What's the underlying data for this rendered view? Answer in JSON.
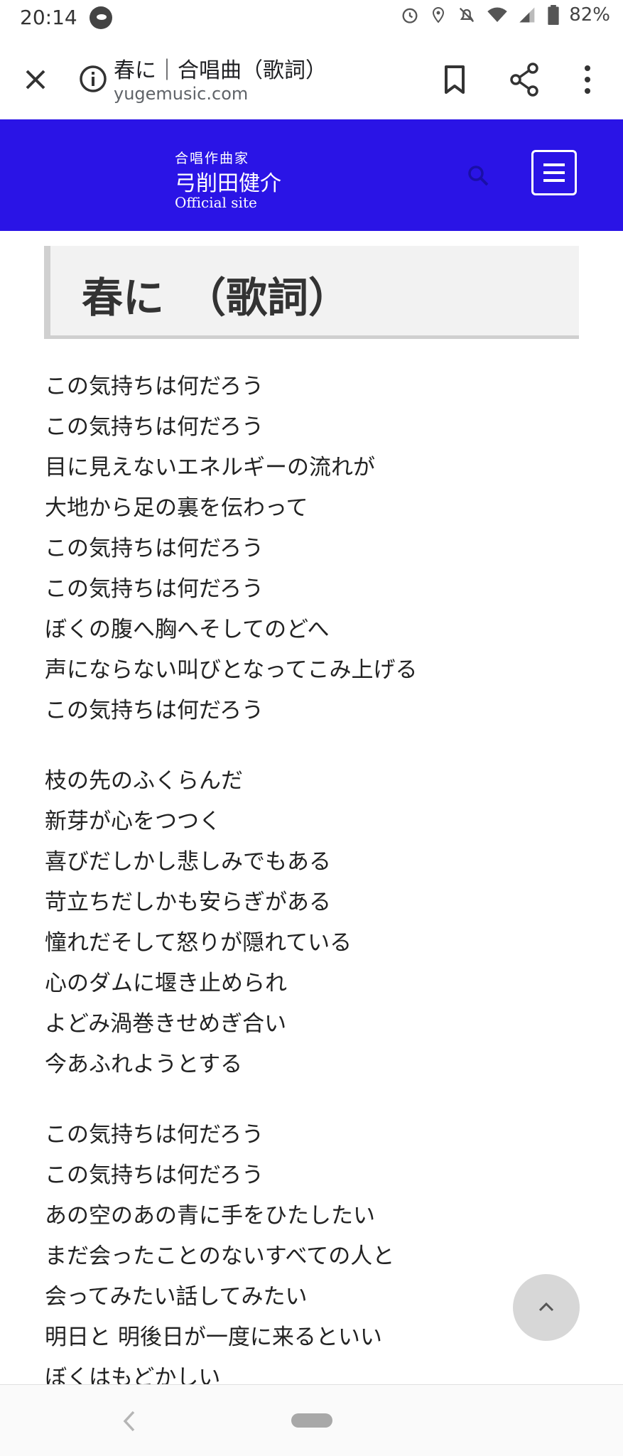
{
  "status_bar": {
    "time": "20:14",
    "battery": "82%",
    "icons": [
      "app-notification-icon",
      "alarm-icon",
      "location-icon",
      "mute-icon",
      "wifi-icon",
      "signal-icon",
      "battery-icon"
    ]
  },
  "browser": {
    "page_title": "春に｜合唱曲（歌詞）",
    "url": "yugemusic.com",
    "icons": [
      "close-icon",
      "info-icon",
      "bookmark-icon",
      "share-icon",
      "more-icon"
    ]
  },
  "site": {
    "logo_line1": "合唱作曲家",
    "logo_line2": "弓削田健介",
    "logo_line3": "Official site",
    "header_color": "#2a14e6",
    "icons": [
      "search-icon",
      "hamburger-menu-icon"
    ]
  },
  "article": {
    "title": "春に　（歌詞）"
  },
  "lyrics": {
    "stanza1": [
      "この気持ちは何だろう",
      "この気持ちは何だろう",
      "目に見えないエネルギーの流れが",
      "大地から足の裏を伝わって",
      "この気持ちは何だろう",
      "この気持ちは何だろう",
      "ぼくの腹へ胸へそしてのどへ",
      "声にならない叫びとなってこみ上げる",
      "この気持ちは何だろう"
    ],
    "stanza2": [
      "枝の先のふくらんだ",
      "新芽が心をつつく",
      "喜びだしかし悲しみでもある",
      "苛立ちだしかも安らぎがある",
      "憧れだそして怒りが隠れている",
      "心のダムに堰き止められ",
      "よどみ渦巻きせめぎ合い",
      "今あふれようとする"
    ],
    "stanza3": [
      "この気持ちは何だろう",
      "この気持ちは何だろう",
      "あの空のあの青に手をひたしたい",
      "まだ会ったことのないすべての人と",
      "会ってみたい話してみたい",
      "明日と 明後日が一度に来るといい",
      "ぼくはもどかしい"
    ]
  },
  "controls": {
    "scroll_top_icon": "chevron-up-icon"
  }
}
